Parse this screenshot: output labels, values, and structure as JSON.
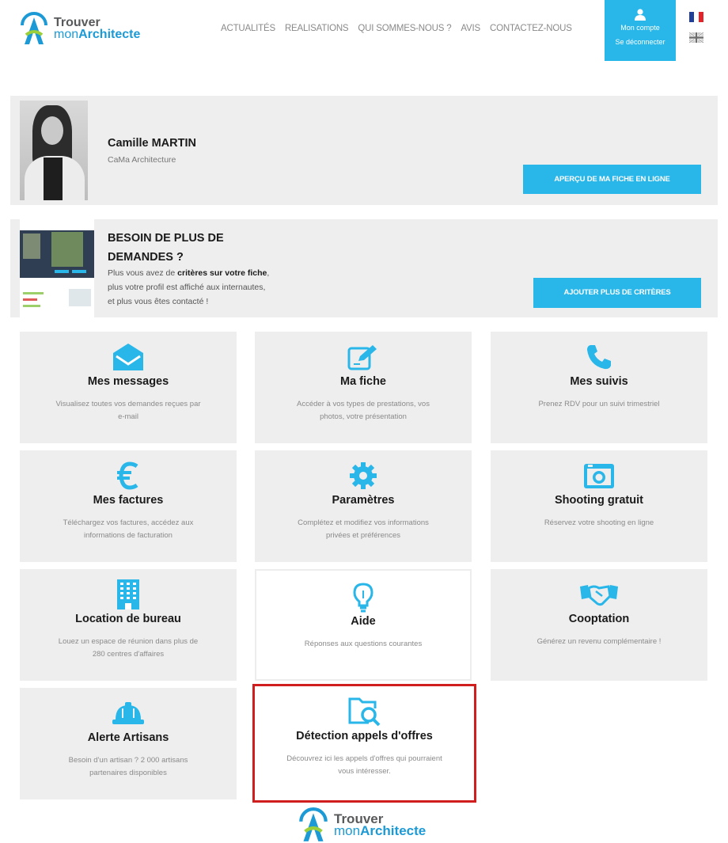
{
  "header": {
    "logo": {
      "line1": "Trouver",
      "line2_light": "mon",
      "line2_bold": "Architecte"
    },
    "nav": [
      "ACTUALITÉS",
      "REALISATIONS",
      "QUI SOMMES-NOUS ?",
      "AVIS",
      "CONTACTEZ-NOUS"
    ],
    "account": {
      "label": "Mon compte",
      "logout": "Se déconnecter"
    },
    "languages": [
      "fr-flag",
      "uk-flag"
    ]
  },
  "profile": {
    "name": "Camille MARTIN",
    "company": "CaMa Architecture",
    "preview_button": "APERÇU DE MA FICHE EN LIGNE"
  },
  "promo": {
    "title": "BESOIN DE PLUS DE DEMANDES ?",
    "desc_part1": "Plus vous avez de ",
    "desc_bold": "critères sur votre fiche",
    "desc_part2": ", plus votre profil est affiché aux internautes, et plus vous êtes contacté !",
    "button": "AJOUTER PLUS DE CRITÈRES"
  },
  "tiles": [
    {
      "title": "Mes messages",
      "desc": "Visualisez toutes vos demandes reçues par e-mail",
      "icon": "envelope-icon"
    },
    {
      "title": "Ma fiche",
      "desc": "Accéder à vos types de prestations, vos photos, votre présentation",
      "icon": "edit-icon"
    },
    {
      "title": "Mes suivis",
      "desc": "Prenez RDV pour un suivi trimestriel",
      "icon": "phone-icon"
    },
    {
      "title": "Mes factures",
      "desc": "Téléchargez vos factures, accédez aux informations de facturation",
      "icon": "euro-icon"
    },
    {
      "title": "Paramètres",
      "desc": "Complétez et modifiez vos informations privées et préférences",
      "icon": "gear-icon"
    },
    {
      "title": "Shooting gratuit",
      "desc": "Réservez votre shooting en ligne",
      "icon": "camera-icon"
    },
    {
      "title": "Location de bureau",
      "desc": "Louez un espace de réunion dans plus de 280 centres d'affaires",
      "icon": "building-icon"
    },
    {
      "title": "Aide",
      "desc": "Réponses aux questions courantes",
      "icon": "lightbulb-icon"
    },
    {
      "title": "Cooptation",
      "desc": "Générez un revenu complémentaire !",
      "icon": "handshake-icon"
    },
    {
      "title": "Alerte Artisans",
      "desc": "Besoin d'un artisan ? 2 000 artisans partenaires disponibles",
      "icon": "hardhat-icon"
    },
    {
      "title": "Détection appels d'offres",
      "desc": "Découvrez ici les appels d'offres qui pourraient vous intéresser.",
      "icon": "folder-search-icon"
    }
  ],
  "colors": {
    "accent": "#29b6e9",
    "tile_bg": "#eeeeee",
    "highlight": "#d01e1e"
  }
}
